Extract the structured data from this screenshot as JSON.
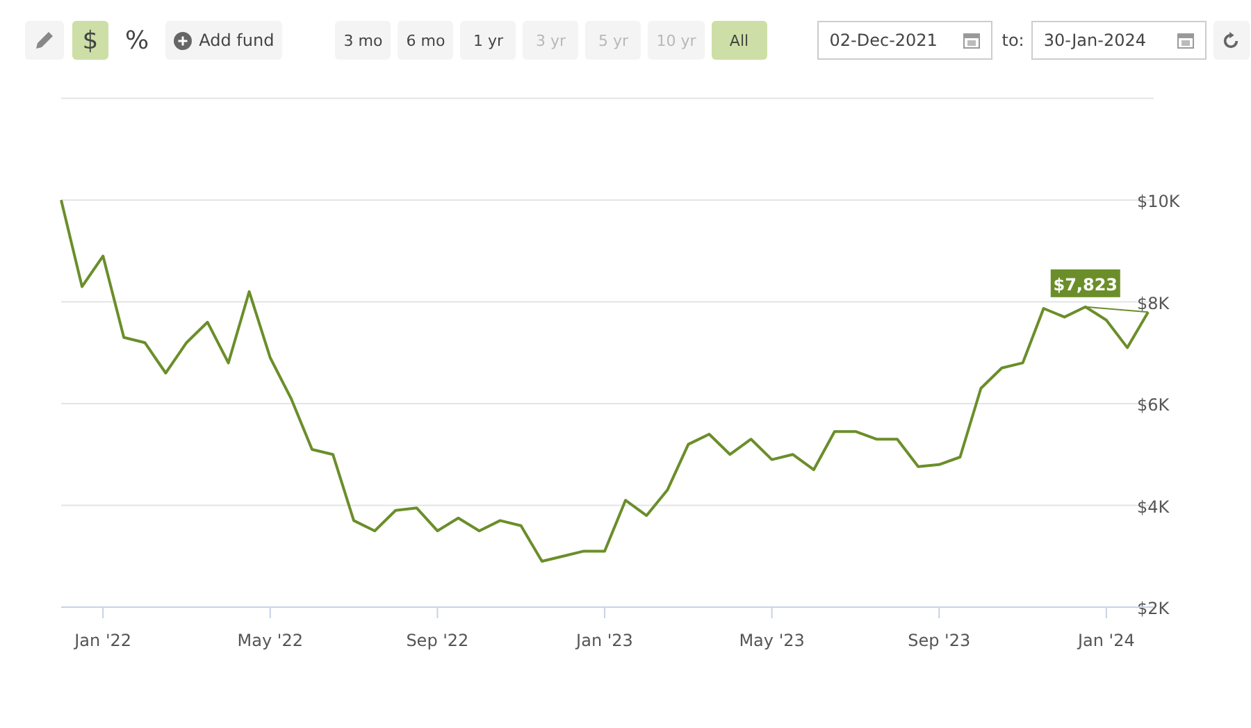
{
  "toolbar": {
    "modes": [
      {
        "kind": "edit",
        "selected": false
      },
      {
        "kind": "dollar",
        "label": "$",
        "selected": true
      },
      {
        "kind": "percent",
        "label": "%",
        "selected": false
      }
    ],
    "add_fund": "Add fund"
  },
  "ranges": [
    {
      "label": "3 mo",
      "selected": false,
      "disabled": false
    },
    {
      "label": "6 mo",
      "selected": false,
      "disabled": false
    },
    {
      "label": "1 yr",
      "selected": false,
      "disabled": false
    },
    {
      "label": "3 yr",
      "selected": false,
      "disabled": true
    },
    {
      "label": "5 yr",
      "selected": false,
      "disabled": true
    },
    {
      "label": "10 yr",
      "selected": false,
      "disabled": true
    },
    {
      "label": "All",
      "selected": true,
      "disabled": false
    }
  ],
  "date_from": "02-Dec-2021",
  "to_label": "to:",
  "date_to": "30-Jan-2024",
  "chart_data": {
    "type": "line",
    "categories": [
      null,
      null,
      "Jan '22",
      null,
      null,
      null,
      null,
      null,
      null,
      null,
      "May '22",
      null,
      null,
      null,
      null,
      null,
      null,
      null,
      "Sep '22",
      null,
      null,
      null,
      null,
      null,
      null,
      null,
      "Jan '23",
      null,
      null,
      null,
      null,
      null,
      null,
      null,
      "May '23",
      null,
      null,
      null,
      null,
      null,
      null,
      null,
      "Sep '23",
      null,
      null,
      null,
      null,
      null,
      null,
      null,
      "Jan '24",
      null,
      null
    ],
    "series": [
      {
        "color": "#6b8e2a",
        "values": [
          10000,
          8300,
          8900,
          7300,
          7200,
          6600,
          7200,
          7600,
          6800,
          8200,
          6900,
          6100,
          5100,
          5000,
          3700,
          3500,
          3900,
          3950,
          3500,
          3750,
          3500,
          3700,
          3600,
          2900,
          3000,
          3100,
          3100,
          4100,
          3800,
          4300,
          5200,
          5400,
          5000,
          5300,
          4900,
          5000,
          4700,
          5450,
          5450,
          5300,
          5300,
          4760,
          4800,
          4950,
          6300,
          6700,
          6800,
          7870,
          7700,
          7900,
          7640,
          7100,
          7800
        ]
      }
    ],
    "ylim": [
      2000,
      12000
    ],
    "yticks": [
      {
        "value": 2000,
        "label": "$2K"
      },
      {
        "value": 4000,
        "label": "$4K"
      },
      {
        "value": 6000,
        "label": "$6K"
      },
      {
        "value": 8000,
        "label": "$8K"
      },
      {
        "value": 10000,
        "label": "$10K"
      }
    ],
    "grid": true,
    "annotations": [
      {
        "y": 7900,
        "text": "$7,823"
      }
    ]
  }
}
